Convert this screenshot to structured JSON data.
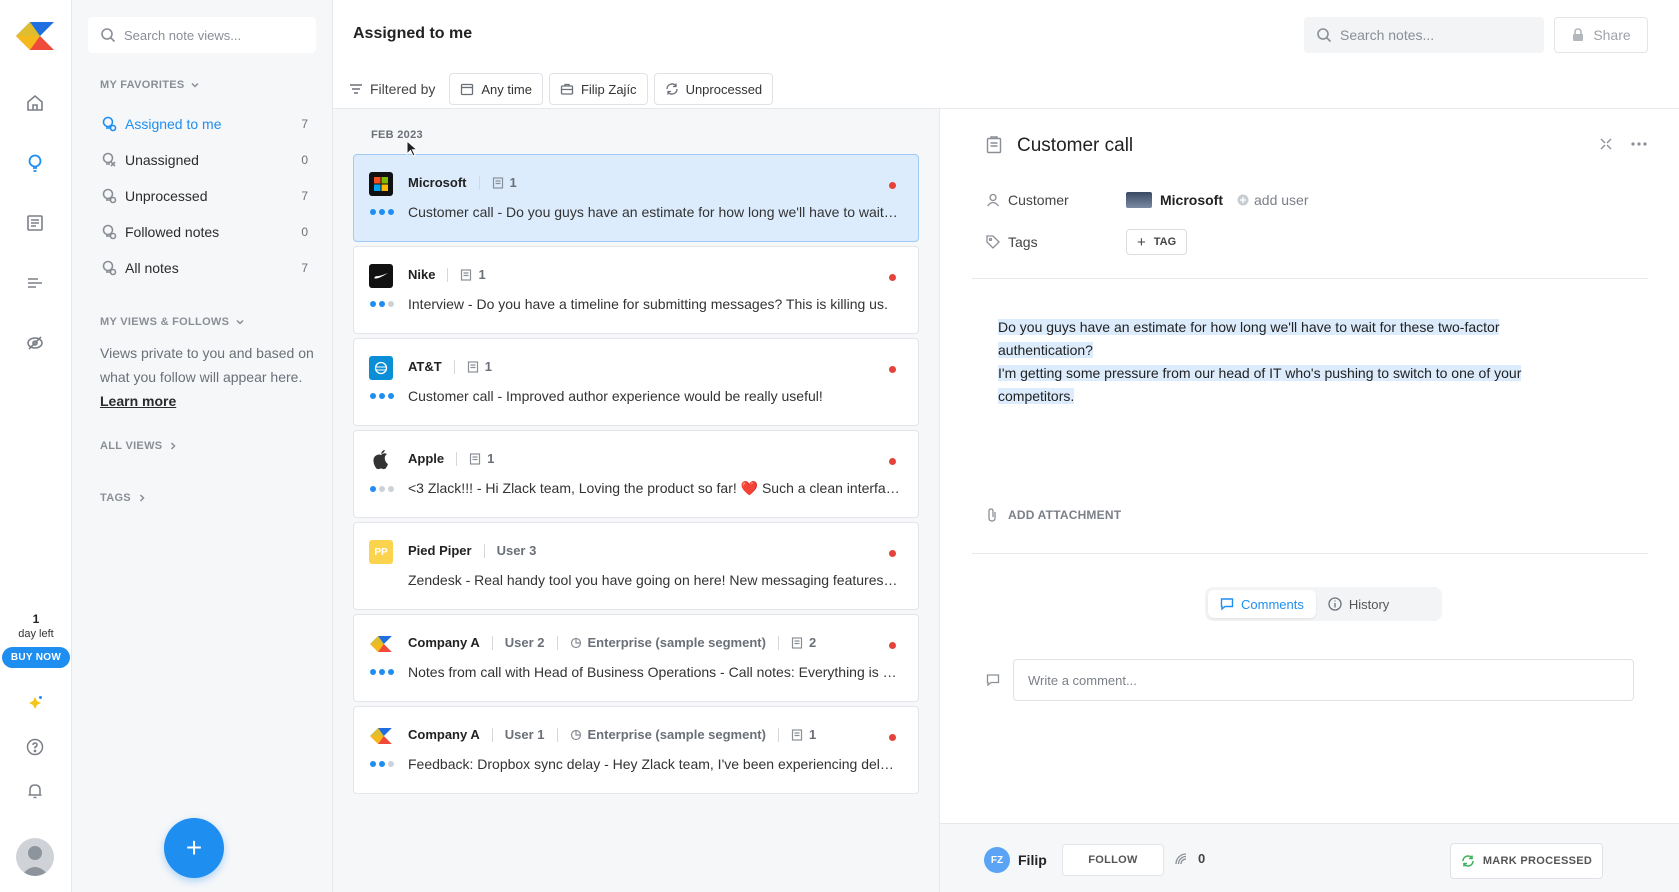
{
  "rail": {
    "trial_days": "1",
    "trial_label": "day left",
    "buy_label": "BUY NOW"
  },
  "sidebar": {
    "search_placeholder": "Search note views...",
    "favorites_header": "MY FAVORITES",
    "items": [
      {
        "label": "Assigned to me",
        "count": "7"
      },
      {
        "label": "Unassigned",
        "count": "0"
      },
      {
        "label": "Unprocessed",
        "count": "7"
      },
      {
        "label": "Followed notes",
        "count": "0"
      },
      {
        "label": "All notes",
        "count": "7"
      }
    ],
    "views_header": "MY VIEWS & FOLLOWS",
    "views_text": "Views private to you and based on what you follow will appear here.",
    "learn_more": "Learn more",
    "all_views": "ALL VIEWS",
    "tags": "TAGS",
    "fab_label": "+"
  },
  "header": {
    "title": "Assigned to me",
    "search_placeholder": "Search notes...",
    "share_label": "Share"
  },
  "filters": {
    "label": "Filtered by",
    "chips": [
      "Any time",
      "Filip Zajíc",
      "Unprocessed"
    ]
  },
  "list": {
    "month": "FEB 2023",
    "notes": [
      {
        "company": "Microsoft",
        "meta1": "1",
        "text": "Customer call - Do you guys have an estimate for how long we'll have to wait for these two-factor authentication?"
      },
      {
        "company": "Nike",
        "meta1": "1",
        "text": "Interview - Do you have a timeline for submitting messages? This is killing us."
      },
      {
        "company": "AT&T",
        "meta1": "1",
        "text": "Customer call - Improved author experience would be really useful!"
      },
      {
        "company": "Apple",
        "meta1": "1",
        "text": "<3 Zlack!!! - Hi Zlack team, Loving the product so far! ❤️ Such a clean interface and easy to use"
      },
      {
        "company": "Pied Piper",
        "user": "User 3",
        "text": "Zendesk - Real handy tool you have going on here! New messaging features are great"
      },
      {
        "company": "Company A",
        "user": "User 2",
        "segment": "Enterprise (sample segment)",
        "meta1": "2",
        "text": "Notes from call with Head of Business Operations - Call notes: Everything is going well"
      },
      {
        "company": "Company A",
        "user": "User 1",
        "segment": "Enterprise (sample segment)",
        "meta1": "1",
        "text": "Feedback: Dropbox sync delay - Hey Zlack team, I've been experiencing delays with Dropbox sync"
      }
    ]
  },
  "detail": {
    "title": "Customer call",
    "customer_label": "Customer",
    "customer_value": "Microsoft",
    "add_user": "add user",
    "tags_label": "Tags",
    "tag_button": "TAG",
    "body_line1": "Do you guys have an estimate for how long we'll have to wait for these two-factor authentication?",
    "body_line2": "I'm getting some pressure from our head of IT who's pushing to switch to one of your competitors.",
    "add_attachment": "ADD ATTACHMENT",
    "tab_comments": "Comments",
    "tab_history": "History",
    "comment_placeholder": "Write a comment...",
    "footer": {
      "initials": "FZ",
      "name": "Filip",
      "follow": "FOLLOW",
      "count": "0",
      "mark_processed": "MARK PROCESSED"
    }
  },
  "colors": {
    "accent": "#1f8ef1",
    "unread": "#e5423b",
    "selected_bg": "#dcecfd"
  }
}
